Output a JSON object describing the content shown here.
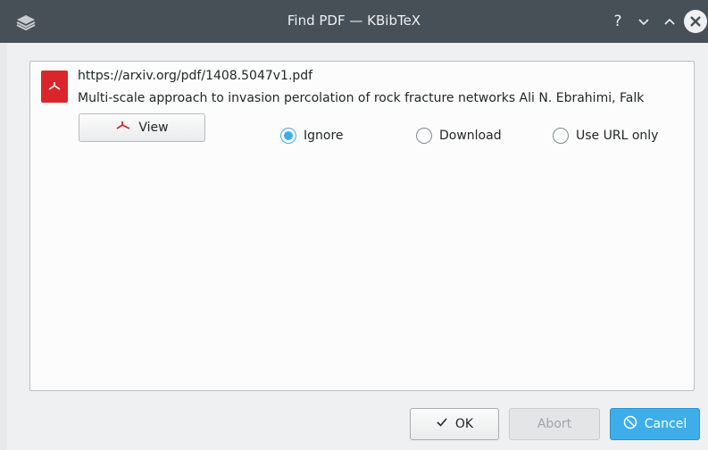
{
  "window": {
    "title": "Find PDF — KBibTeX",
    "controls": {
      "help": "?",
      "minimize": "⌄",
      "maximize": "⌃",
      "close": "✕"
    }
  },
  "result": {
    "url": "https://arxiv.org/pdf/1408.5047v1.pdf",
    "title": "Multi-scale approach to invasion percolation of rock fracture networks Ali N. Ebrahimi, Falk",
    "view_label": "View",
    "options": [
      {
        "label": "Ignore",
        "selected": true
      },
      {
        "label": "Download",
        "selected": false
      },
      {
        "label": "Use URL only",
        "selected": false
      }
    ]
  },
  "buttons": {
    "ok": "OK",
    "abort": "Abort",
    "cancel": "Cancel"
  },
  "colors": {
    "titlebar": "#475057",
    "accent": "#3daee9",
    "pdf_red": "#d9262b"
  }
}
